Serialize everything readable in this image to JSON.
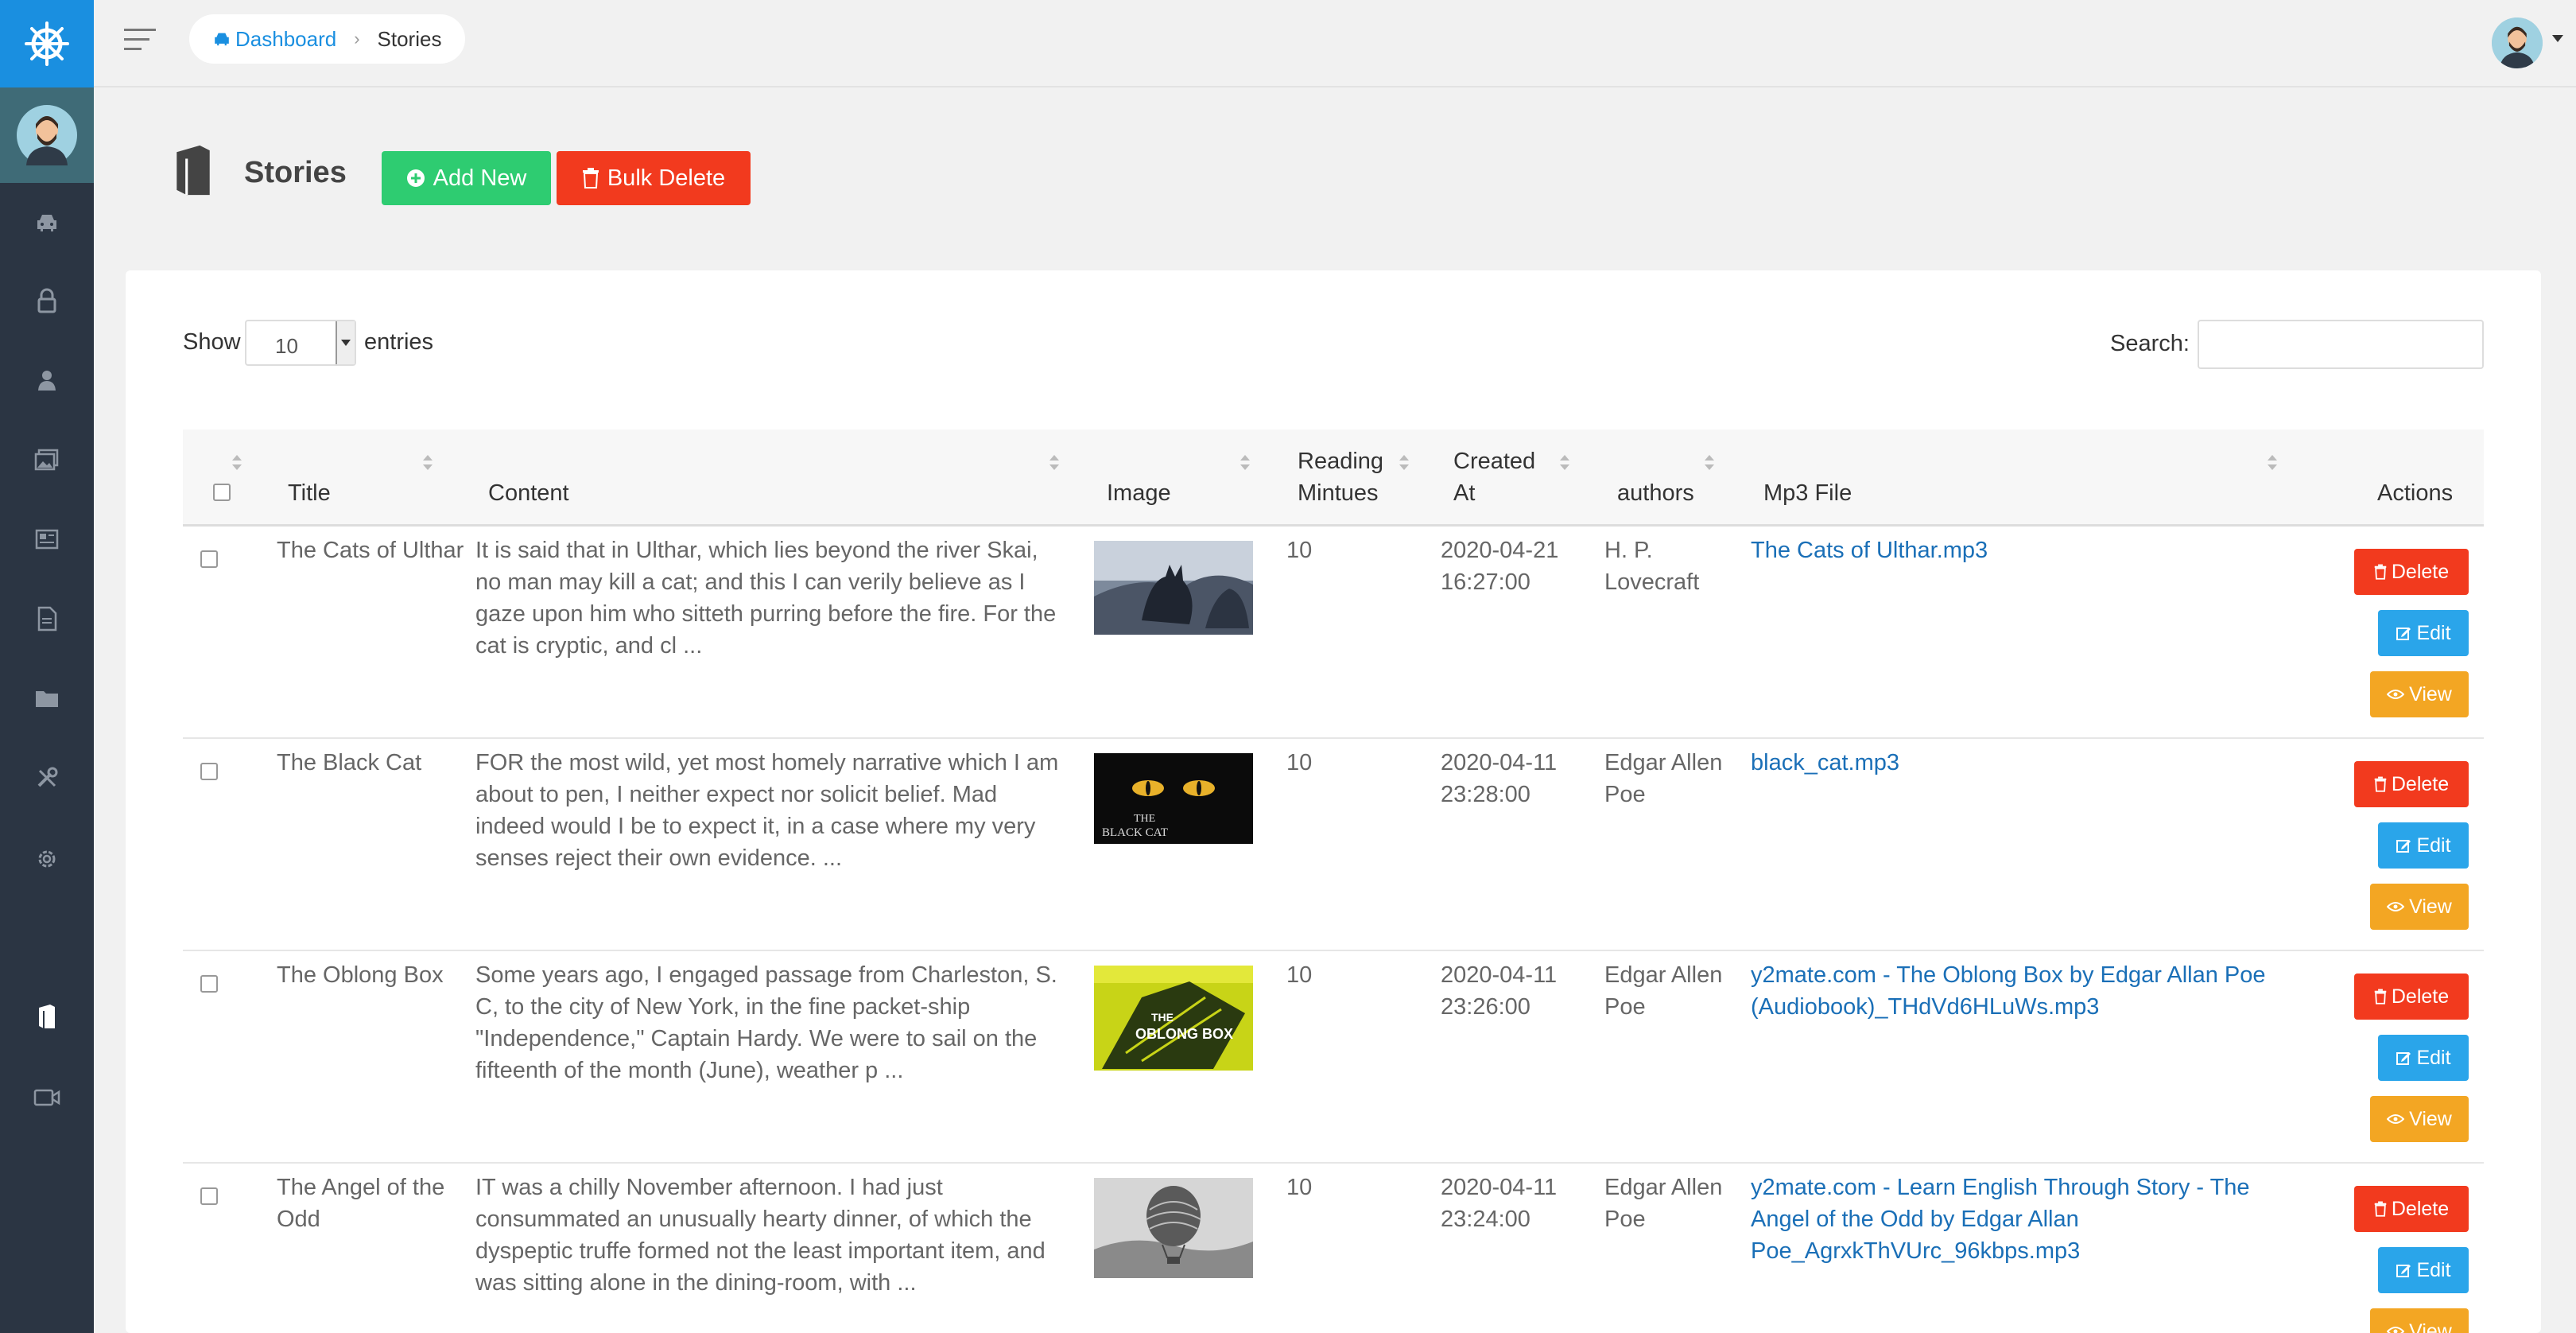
{
  "breadcrumb": {
    "home": "Dashboard",
    "current": "Stories"
  },
  "page": {
    "title": "Stories",
    "add_label": "Add New",
    "bulk_delete_label": "Bulk Delete"
  },
  "table_controls": {
    "show_label": "Show",
    "entries_value": "10",
    "entries_label": "entries",
    "search_label": "Search:"
  },
  "columns": {
    "title": "Title",
    "content": "Content",
    "image": "Image",
    "reading_1": "Reading",
    "reading_2": "Mintues",
    "created_1": "Created",
    "created_2": "At",
    "authors": "authors",
    "mp3": "Mp3 File",
    "actions": "Actions"
  },
  "actions": {
    "delete": "Delete",
    "edit": "Edit",
    "view": "View"
  },
  "rows": [
    {
      "title": "The Cats of Ulthar",
      "content": "It is said that in Ulthar, which lies beyond the river Skai, no man may kill a cat; and this I can verily believe as I gaze upon him who sitteth purring before the fire. For the cat is cryptic, and cl ...",
      "reading": "10",
      "created_date": "2020-04-21",
      "created_time": "16:27:00",
      "author": "H. P. Lovecraft",
      "mp3": "The Cats of Ulthar.mp3"
    },
    {
      "title": "The Black Cat",
      "content": "FOR the most wild, yet most homely narrative which I am about to pen, I neither expect nor solicit belief. Mad indeed would I be to expect it, in a case where my very senses reject their own evidence. ...",
      "reading": "10",
      "created_date": "2020-04-11",
      "created_time": "23:28:00",
      "author": "Edgar Allen Poe",
      "mp3": "black_cat.mp3",
      "image_text_1": "THE",
      "image_text_2": "BLACK CAT"
    },
    {
      "title": "The Oblong Box",
      "content": "Some years ago, I engaged passage from Charleston, S. C, to the city of New York, in the fine packet-ship \"Independence,\" Captain Hardy. We were to sail on the fifteenth of the month (June), weather p ...",
      "reading": "10",
      "created_date": "2020-04-11",
      "created_time": "23:26:00",
      "author": "Edgar Allen Poe",
      "mp3": "y2mate.com - The Oblong Box by Edgar Allan Poe (Audiobook)_THdVd6HLuWs.mp3",
      "image_text_1": "THE",
      "image_text_2": "OBLONG BOX"
    },
    {
      "title": "The Angel of the Odd",
      "content": "IT was a chilly November afternoon. I had just consummated an unusually hearty dinner, of which the dyspeptic truffe formed not the least important item, and was sitting alone in the dining-room, with ...",
      "reading": "10",
      "created_date": "2020-04-11",
      "created_time": "23:24:00",
      "author": "Edgar Allen Poe",
      "mp3": "y2mate.com - Learn English Through Story - The Angel of the Odd by Edgar Allan Poe_AgrxkThVUrc_96kbps.mp3"
    }
  ],
  "colors": {
    "sidebar": "#2b3543",
    "brand": "#1a8fe0",
    "add": "#2ecc71",
    "delete": "#f23a1e",
    "edit": "#2aa5ea",
    "view": "#f3a623",
    "link": "#1a6fb7"
  },
  "icons": {
    "logo": "ship-wheel-icon",
    "sidebar": [
      "car-icon",
      "lock-icon",
      "user-icon",
      "images-icon",
      "newspaper-icon",
      "file-icon",
      "folder-icon",
      "tools-icon",
      "gear-icon",
      "book-icon",
      "video-icon"
    ]
  }
}
